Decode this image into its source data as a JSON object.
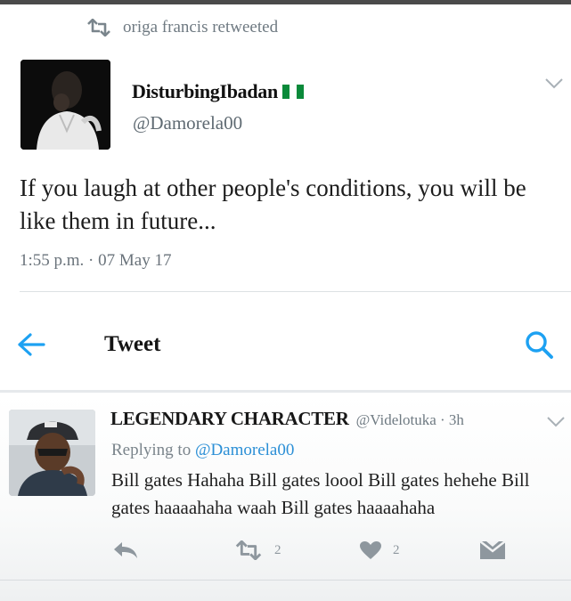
{
  "retweet": {
    "icon": "retweet-icon",
    "text": "origa francis retweeted"
  },
  "original_tweet": {
    "display_name": "DisturbingIbadan",
    "flag": "nigeria-flag",
    "handle": "@Damorela00",
    "text": "If you laugh at other people's conditions, you will be like them in future...",
    "timestamp": "1:55 p.m. · 07 May 17",
    "menu_icon": "chevron-down-icon"
  },
  "nav": {
    "back_icon": "back-arrow-icon",
    "title": "Tweet",
    "search_icon": "search-icon"
  },
  "reply": {
    "display_name": "LEGENDARY CHARACTER",
    "handle_time": "@Videlotuka · 3h",
    "replying_prefix": "Replying to",
    "replying_mention": "@Damorela00",
    "text": "Bill gates Hahaha Bill gates loool Bill gates hehehe Bill gates haaaahaha waah Bill gates haaaahaha",
    "menu_icon": "chevron-down-icon",
    "actions": {
      "reply_icon": "reply-icon",
      "retweet_icon": "retweet-icon",
      "retweet_count": "2",
      "like_icon": "heart-icon",
      "like_count": "2",
      "dm_icon": "envelope-icon"
    }
  },
  "colors": {
    "accent": "#1da1f2",
    "muted": "#6f7a82",
    "flag_green": "#0a8a3a"
  }
}
